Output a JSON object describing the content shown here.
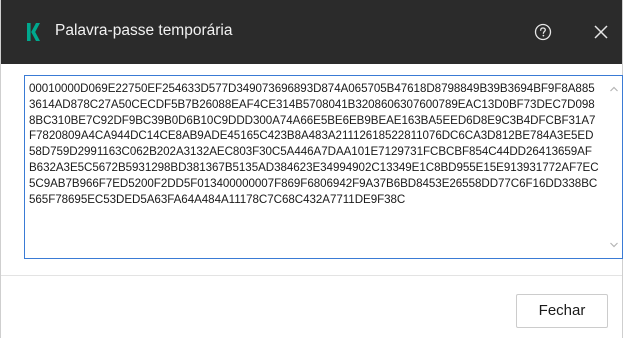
{
  "window": {
    "title": "Palavra-passe temporária",
    "help_icon": "help-circle-icon",
    "close_icon": "close-icon",
    "logo_icon": "kaspersky-k-logo",
    "accent_color": "#00a88e"
  },
  "textbox": {
    "value": "00010000D069E22750EF254633D577D349073696893D874A065705B47618D8798849B39B3694BF9F8A8853614AD878C27A50CECDF5B7B26088EAF4CE314B5708041B3208606307600789EAC13D0BF73DEC7D0988BC310BE7C92DF9BC39B0D6B10C9DDD300A74A66E5BE6EB9BEAE163BA5EED6D8E9C3B4DFCBF31A7F7820809A4CA944DC14CE8AB9ADE45165C423B8A483A21112618522811076DC6CA3D812BE784A3E5ED58D759D2991163C062B202A3132AEC803F30C5A446A7DAA101E7129731FCBCBF854C44DD26413659AFB632A3E5C5672B5931298BD381367B5135AD384623E34994902C13349E1C8BD955E15E913931772AF7EC5C9AB7B966F7ED5200F2DD5F013400000007F869F6806942F9A37B6BD8453E26558DD77C6F16DD338BC565F78695EC53DED5A63FA64A484A11178C7C68C432A7711DE9F38C"
  },
  "footer": {
    "close_label": "Fechar"
  }
}
